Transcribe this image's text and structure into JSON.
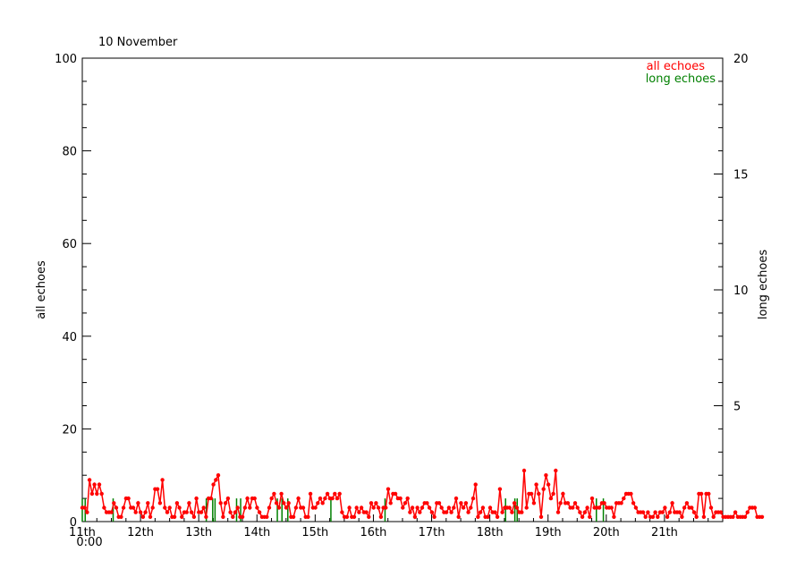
{
  "chart_data": {
    "type": "line",
    "title": "10 November",
    "ylabel": "all echoes",
    "y2label": "long echoes",
    "ylim": [
      0,
      100
    ],
    "y2lim": [
      0,
      20
    ],
    "xlim": [
      0,
      11
    ],
    "x_ticks": [
      {
        "x": 0,
        "label": "11th",
        "sublabel": "0:00"
      },
      {
        "x": 1,
        "label": "12th"
      },
      {
        "x": 2,
        "label": "13th"
      },
      {
        "x": 3,
        "label": "14th"
      },
      {
        "x": 4,
        "label": "15th"
      },
      {
        "x": 5,
        "label": "16th"
      },
      {
        "x": 6,
        "label": "17th"
      },
      {
        "x": 7,
        "label": "18th"
      },
      {
        "x": 8,
        "label": "19th"
      },
      {
        "x": 9,
        "label": "20th"
      },
      {
        "x": 10,
        "label": "21th"
      }
    ],
    "y_ticks": [
      0,
      20,
      40,
      60,
      80,
      100
    ],
    "y2_ticks": [
      5,
      10,
      15,
      20
    ],
    "legend": {
      "position": "top-right",
      "entries": [
        {
          "label": "all echoes",
          "color": "#ff0000"
        },
        {
          "label": "long echoes",
          "color": "#008000"
        }
      ]
    },
    "series": [
      {
        "name": "all echoes",
        "axis": "left",
        "color": "#ff0000",
        "x_step_days": 0.0417,
        "values": [
          3,
          3,
          2,
          9,
          6,
          8,
          6,
          8,
          6,
          3,
          2,
          2,
          2,
          4,
          3,
          1,
          1,
          3,
          5,
          5,
          3,
          3,
          2,
          4,
          2,
          1,
          2,
          4,
          1,
          3,
          7,
          7,
          4,
          9,
          3,
          2,
          3,
          1,
          1,
          4,
          3,
          1,
          2,
          2,
          4,
          2,
          1,
          5,
          2,
          2,
          3,
          1,
          5,
          5,
          8,
          9,
          10,
          4,
          1,
          4,
          5,
          2,
          1,
          2,
          3,
          1,
          1,
          3,
          5,
          3,
          5,
          5,
          3,
          2,
          1,
          1,
          1,
          3,
          5,
          6,
          4,
          3,
          6,
          4,
          3,
          4,
          1,
          1,
          3,
          5,
          3,
          3,
          1,
          1,
          6,
          3,
          3,
          4,
          5,
          4,
          5,
          6,
          5,
          5,
          6,
          5,
          6,
          2,
          1,
          1,
          3,
          1,
          1,
          3,
          2,
          3,
          2,
          2,
          1,
          4,
          3,
          4,
          3,
          1,
          3,
          3,
          7,
          4,
          6,
          6,
          5,
          5,
          3,
          4,
          5,
          2,
          3,
          1,
          3,
          2,
          3,
          4,
          4,
          3,
          2,
          1,
          4,
          4,
          3,
          2,
          2,
          3,
          2,
          3,
          5,
          1,
          4,
          3,
          4,
          2,
          3,
          5,
          8,
          1,
          2,
          3,
          1,
          1,
          3,
          2,
          2,
          1,
          7,
          2,
          3,
          3,
          3,
          2,
          4,
          3,
          2,
          2,
          11,
          3,
          6,
          6,
          4,
          8,
          6,
          1,
          7,
          10,
          8,
          5,
          6,
          11,
          2,
          4,
          6,
          4,
          4,
          3,
          3,
          4,
          3,
          2,
          1,
          2,
          3,
          1,
          5,
          3,
          3,
          3,
          4,
          4,
          3,
          3,
          3,
          1,
          4,
          4,
          4,
          5,
          6,
          6,
          6,
          4,
          3,
          2,
          2,
          2,
          1,
          2,
          1,
          1,
          2,
          1,
          2,
          2,
          3,
          1,
          2,
          4,
          2,
          2,
          2,
          1,
          3,
          4,
          3,
          3,
          2,
          1,
          6,
          6,
          1,
          6,
          6,
          3,
          1,
          2,
          2,
          2,
          1,
          1,
          1,
          1,
          1,
          2,
          1,
          1,
          1,
          1,
          2,
          3,
          3,
          3,
          1,
          1,
          1
        ]
      },
      {
        "name": "long echoes",
        "axis": "right",
        "color": "#008000",
        "spikes": [
          {
            "x": 0.0,
            "value": 1
          },
          {
            "x": 0.05,
            "value": 1
          },
          {
            "x": 0.53,
            "value": 1
          },
          {
            "x": 2.13,
            "value": 1
          },
          {
            "x": 2.24,
            "value": 1
          },
          {
            "x": 2.28,
            "value": 1
          },
          {
            "x": 2.65,
            "value": 1
          },
          {
            "x": 2.72,
            "value": 1
          },
          {
            "x": 3.35,
            "value": 1
          },
          {
            "x": 3.43,
            "value": 1
          },
          {
            "x": 3.53,
            "value": 1
          },
          {
            "x": 4.27,
            "value": 1
          },
          {
            "x": 5.2,
            "value": 1
          },
          {
            "x": 7.27,
            "value": 1
          },
          {
            "x": 7.43,
            "value": 1
          },
          {
            "x": 7.47,
            "value": 1
          },
          {
            "x": 8.83,
            "value": 1
          },
          {
            "x": 8.95,
            "value": 1
          }
        ]
      }
    ],
    "grid": false
  }
}
